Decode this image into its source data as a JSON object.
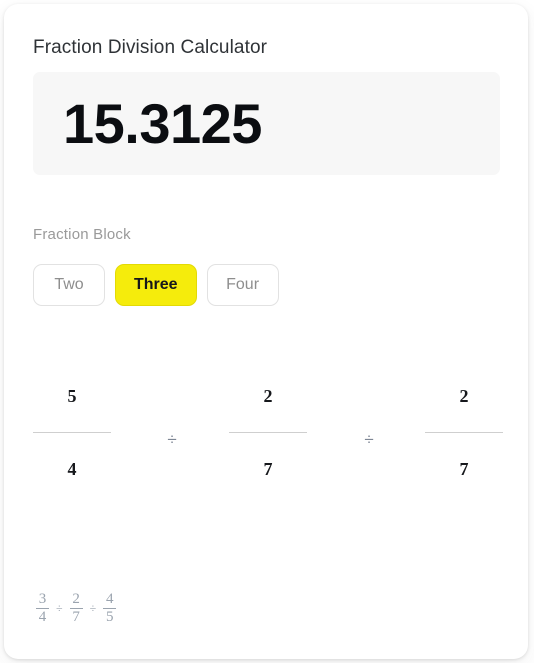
{
  "app": {
    "title": "Fraction Division Calculator"
  },
  "result": {
    "value": "15.3125"
  },
  "block_selector": {
    "label": "Fraction Block",
    "options": [
      {
        "label": "Two",
        "selected": false
      },
      {
        "label": "Three",
        "selected": true
      },
      {
        "label": "Four",
        "selected": false
      }
    ],
    "selected_value": "Three",
    "selected_color": "#f5ec0c"
  },
  "fraction_inputs": {
    "operator": "÷",
    "fractions": [
      {
        "numerator": "5",
        "denominator": "4"
      },
      {
        "numerator": "2",
        "denominator": "7"
      },
      {
        "numerator": "2",
        "denominator": "7"
      }
    ]
  },
  "footer_formula": {
    "operator": "÷",
    "fractions": [
      {
        "numerator": "3",
        "denominator": "4"
      },
      {
        "numerator": "2",
        "denominator": "7"
      },
      {
        "numerator": "4",
        "denominator": "5"
      }
    ]
  }
}
